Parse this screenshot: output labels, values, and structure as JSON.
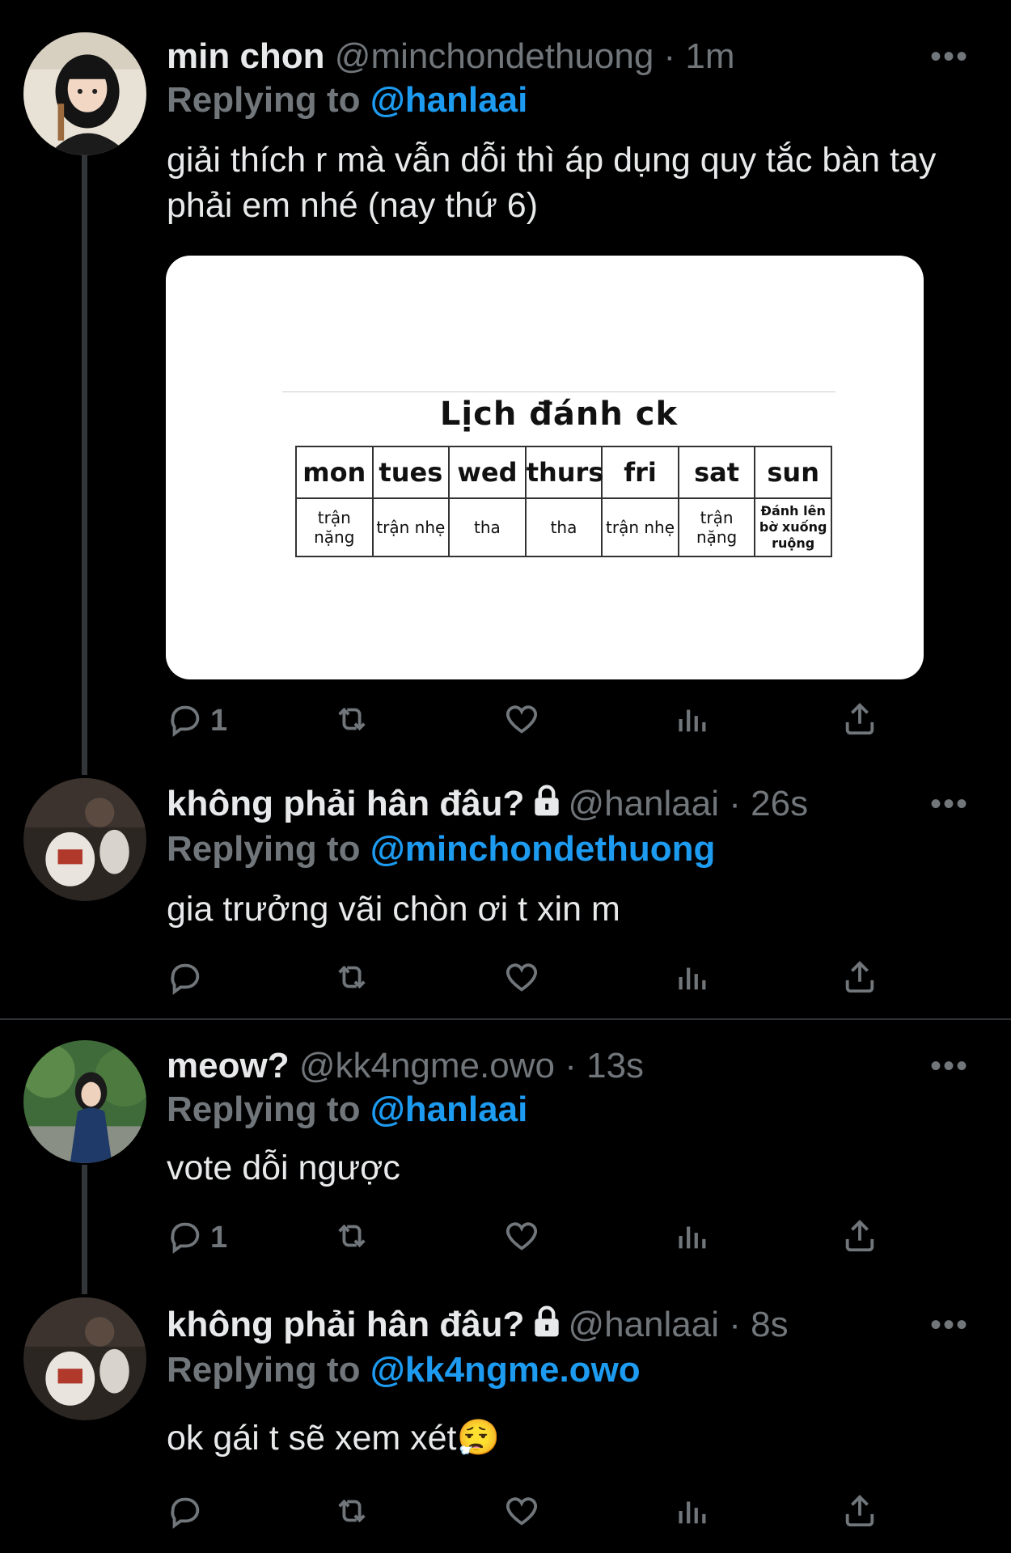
{
  "tweets": [
    {
      "name": "min chon",
      "handle": "@minchondethuong",
      "time": "1m",
      "locked": false,
      "replying_label": "Replying to",
      "replying_to": "@hanlaai",
      "text": "giải thích r mà vẫn dỗi thì áp dụng quy tắc bàn tay phải em nhé (nay thứ 6)",
      "reply_count": "1"
    },
    {
      "name": "không phải hân đâu?",
      "handle": "@hanlaai",
      "time": "26s",
      "locked": true,
      "replying_label": "Replying to",
      "replying_to": "@minchondethuong",
      "text": "gia trưởng vãi chòn ơi t xin m",
      "reply_count": ""
    },
    {
      "name": "meow?",
      "handle": "@kk4ngme.owo",
      "time": "13s",
      "locked": false,
      "replying_label": "Replying to",
      "replying_to": "@hanlaai",
      "text": "vote dỗi ngược",
      "reply_count": "1"
    },
    {
      "name": "không phải hân đâu?",
      "handle": "@hanlaai",
      "time": "8s",
      "locked": true,
      "replying_label": "Replying to",
      "replying_to": "@kk4ngme.owo",
      "text": "ok gái t sẽ xem xét😮‍💨",
      "reply_count": ""
    }
  ],
  "media": {
    "title": "Lịch đánh ck",
    "days": [
      "mon",
      "tues",
      "wed",
      "thurs",
      "fri",
      "sat",
      "sun"
    ],
    "activities": [
      "trận nặng",
      "trận nhẹ",
      "tha",
      "tha",
      "trận nhẹ",
      "trận nặng",
      "Đánh lên bờ xuống ruộng"
    ]
  },
  "meta": {
    "separator": "·",
    "more": "•••"
  },
  "icons": {
    "actions": [
      "reply-icon",
      "retweet-icon",
      "like-icon",
      "views-icon",
      "share-icon"
    ],
    "lock": "lock-icon"
  },
  "colors": {
    "accent": "#1d9bf0",
    "muted": "#71767b",
    "background": "#000000"
  }
}
